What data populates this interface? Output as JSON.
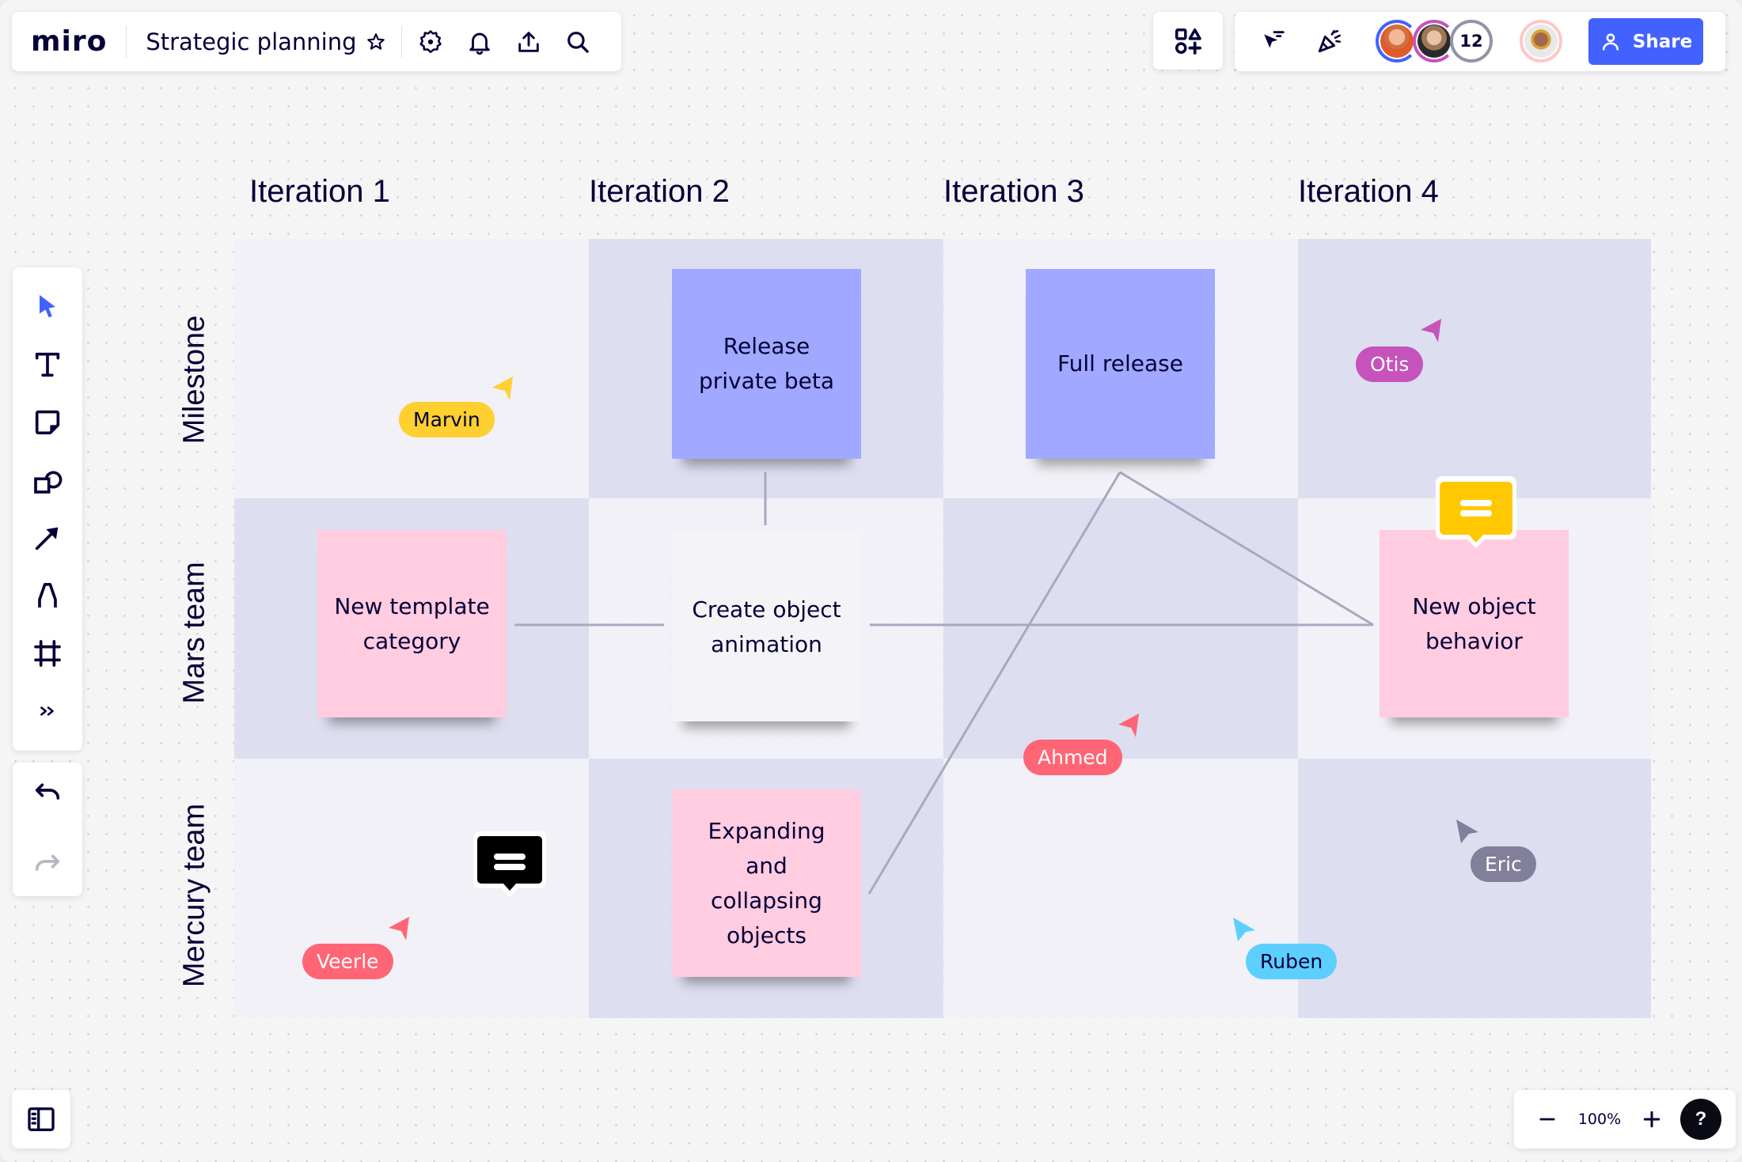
{
  "app": {
    "logo": "miro",
    "board_title": "Strategic planning"
  },
  "toolbar_top_left": {
    "icons": [
      "star-icon",
      "settings-icon",
      "bell-icon",
      "upload-icon",
      "search-icon"
    ]
  },
  "toolbar_top_right": {
    "apps_icon": "shapes-apps-icon",
    "icons": [
      "cursor-filter-icon",
      "celebration-icon"
    ],
    "collaborators": [
      {
        "name": "collaborator-1",
        "ring_color": "#4262ff",
        "face_color": "#e59a6c"
      },
      {
        "name": "collaborator-2",
        "ring_color": "#c653bc",
        "face_color": "#c9a48a"
      }
    ],
    "more_count": "12",
    "more_ring_color": "#9292a8",
    "current_user": {
      "ring_color": "#ffc6c6",
      "face_color": "#a0674d"
    },
    "share_label": "Share",
    "share_color": "#4262ff"
  },
  "left_toolbar": {
    "tools": [
      {
        "name": "select-tool",
        "icon": "pointer-icon",
        "active": true
      },
      {
        "name": "text-tool",
        "icon": "text-icon"
      },
      {
        "name": "sticky-note-tool",
        "icon": "sticky-note-icon"
      },
      {
        "name": "shapes-tool",
        "icon": "shapes-icon"
      },
      {
        "name": "connector-tool",
        "icon": "arrow-icon"
      },
      {
        "name": "pen-tool",
        "icon": "pen-icon"
      },
      {
        "name": "frame-tool",
        "icon": "frame-icon"
      },
      {
        "name": "more-tools",
        "icon": "chevrons-right-icon"
      }
    ],
    "undo": "undo-icon",
    "redo": "redo-icon"
  },
  "bottom": {
    "panel_toggle_icon": "sidebar-icon",
    "zoom_level": "100%",
    "zoom_out_icon": "minus-icon",
    "zoom_in_icon": "plus-icon",
    "help_label": "?"
  },
  "grid": {
    "columns": [
      "Iteration 1",
      "Iteration 2",
      "Iteration 3",
      "Iteration 4"
    ],
    "rows": [
      "Milestone",
      "Mars team",
      "Mercury team"
    ]
  },
  "stickies": [
    {
      "text": "Release\nprivate beta",
      "color": "blue",
      "row": "Milestone",
      "column": "Iteration 2"
    },
    {
      "text": "Full release",
      "color": "blue",
      "row": "Milestone",
      "column": "Iteration 3"
    },
    {
      "text": "New template\ncategory",
      "color": "pink",
      "row": "Mars team",
      "column": "Iteration 1"
    },
    {
      "text": "Create object\nanimation",
      "color": "white",
      "row": "Mars team",
      "column": "Iteration 2"
    },
    {
      "text": "New object\nbehavior",
      "color": "pink",
      "row": "Mars team",
      "column": "Iteration 4"
    },
    {
      "text": "Expanding\nand\ncollapsing\nobjects",
      "color": "pink",
      "row": "Mercury team",
      "column": "Iteration 2"
    }
  ],
  "cursors": [
    {
      "name": "Marvin",
      "color": "#ffd02f",
      "text_color": "#050038"
    },
    {
      "name": "Otis",
      "color": "#c653bc",
      "text_color": "#ffffff"
    },
    {
      "name": "Ahmed",
      "color": "#ff6575",
      "text_color": "#ffffff"
    },
    {
      "name": "Eric",
      "color": "#827f9b",
      "text_color": "#ffffff"
    },
    {
      "name": "Ruben",
      "color": "#5ccfff",
      "text_color": "#050038"
    },
    {
      "name": "Veerle",
      "color": "#ff6575",
      "text_color": "#ffffff"
    }
  ],
  "comments": [
    {
      "name": "comment-yellow",
      "color": "#ffc800"
    },
    {
      "name": "comment-black",
      "color": "#000000"
    }
  ],
  "colors": {
    "ink": "#050038",
    "accent": "#4262ff",
    "sticky_blue": "#a0a9ff",
    "sticky_pink": "#ffcce0",
    "connector": "#a8a8c0"
  }
}
